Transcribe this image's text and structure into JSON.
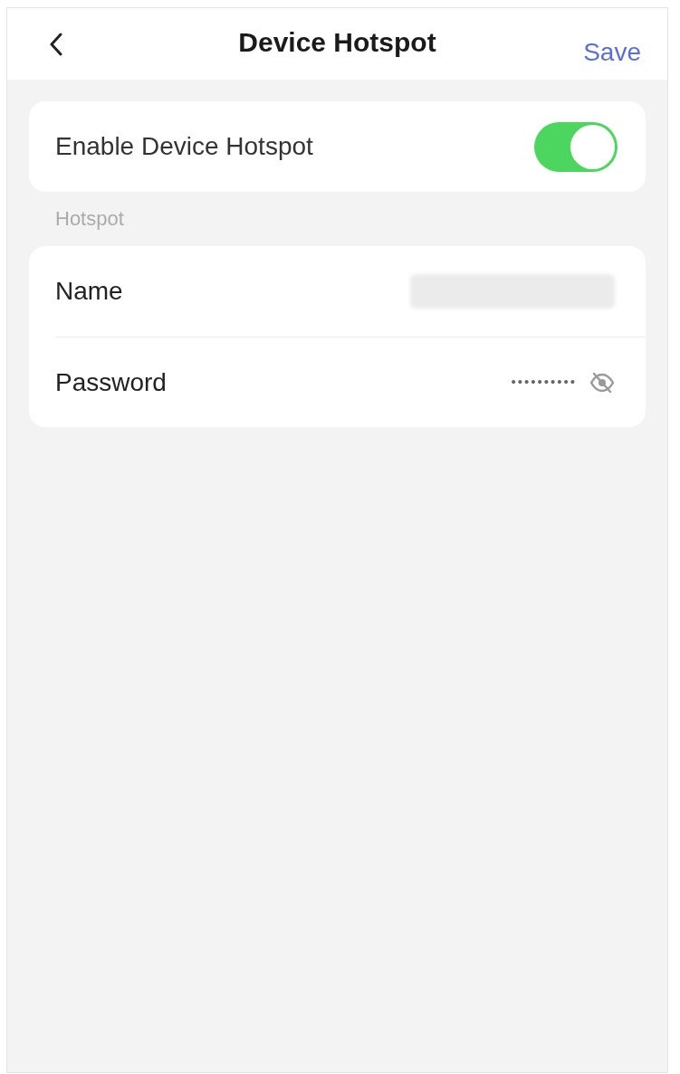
{
  "header": {
    "title": "Device Hotspot",
    "action": "Save"
  },
  "toggle_card": {
    "label": "Enable Device Hotspot",
    "on": true
  },
  "section": {
    "title": "Hotspot",
    "rows": [
      {
        "kind": "blurred",
        "label": "Name"
      },
      {
        "kind": "password",
        "label": "Password",
        "value": "••••••••••"
      }
    ]
  }
}
